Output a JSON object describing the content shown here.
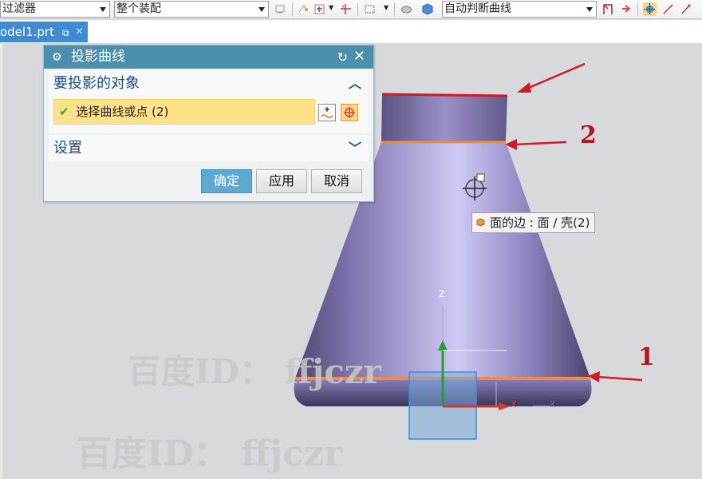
{
  "toolbar": {
    "filter_combo": "过滤器",
    "scope_combo": "整个装配",
    "curve_rule_combo": "自动判断曲线",
    "icons": [
      "view-icon",
      "snap-icon",
      "point-icon",
      "selection-rect-icon",
      "part-icon",
      "body-icon",
      "flag-icon",
      "arrow-icon",
      "grid-snap-icon",
      "line-icon",
      "pin-icon"
    ]
  },
  "tab": {
    "label": "odel1.prt",
    "close_glyph": "×"
  },
  "dialog": {
    "title": "投影曲线",
    "section_objects": "要投影的对象",
    "select_label": "选择曲线或点 (2)",
    "section_settings": "设置",
    "buttons": {
      "ok": "确定",
      "apply": "应用",
      "cancel": "取消"
    }
  },
  "tooltip": {
    "text": "面的边 : 面 / 壳(2)"
  },
  "viewport": {
    "axis_labels": {
      "z": "Z",
      "x": "X"
    },
    "annotations": {
      "one": "1",
      "two": "2"
    },
    "watermarks": [
      "百度ID： ffjczr",
      "百度ID： ffjczr"
    ]
  },
  "colors": {
    "tab_active": "#3d8bd0",
    "dialog_title": "#4a8fab",
    "selection_highlight": "#fde28a",
    "ok_button": "#5daad0",
    "annotation_red": "#d31a20",
    "edge_highlight": "#f08a44",
    "model_body": "#8b7fc0"
  }
}
